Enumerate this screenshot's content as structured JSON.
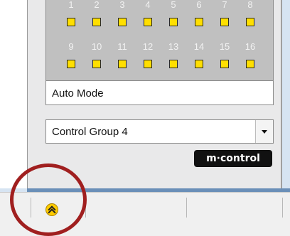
{
  "led_panel": {
    "row1_numbers": [
      "1",
      "2",
      "3",
      "4",
      "5",
      "6",
      "7",
      "8"
    ],
    "row2_numbers": [
      "9",
      "10",
      "11",
      "12",
      "13",
      "14",
      "15",
      "16"
    ],
    "led_color": "#ffdf00"
  },
  "mode": {
    "label": "Auto Mode"
  },
  "group_select": {
    "value": "Control Group 4"
  },
  "brand": {
    "logo_text": "m·control"
  },
  "statusbar": {
    "icon": "chevron-up-icon",
    "icon_color": "#ffcc00"
  },
  "annotation": {
    "color": "#a01f1f"
  }
}
